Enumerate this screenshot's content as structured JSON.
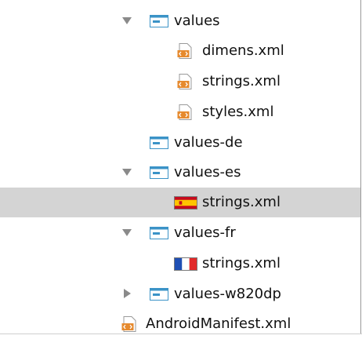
{
  "tree": {
    "items": [
      {
        "label": "values",
        "expanded": true,
        "type": "folder"
      },
      {
        "label": "dimens.xml",
        "type": "xml-file"
      },
      {
        "label": "strings.xml",
        "type": "xml-file"
      },
      {
        "label": "styles.xml",
        "type": "xml-file"
      },
      {
        "label": "values-de",
        "type": "folder"
      },
      {
        "label": "values-es",
        "expanded": true,
        "type": "folder"
      },
      {
        "label": "strings.xml",
        "type": "locale-file",
        "flag": "spain-flag-icon",
        "selected": true
      },
      {
        "label": "values-fr",
        "expanded": true,
        "type": "folder"
      },
      {
        "label": "strings.xml",
        "type": "locale-file",
        "flag": "france-flag-icon"
      },
      {
        "label": "values-w820dp",
        "expanded": false,
        "type": "folder"
      },
      {
        "label": "AndroidManifest.xml",
        "type": "xml-file"
      }
    ]
  },
  "colors": {
    "folder": "#3b93c7",
    "xml_icon": "#e68a2e",
    "selection": "#d4d4d4",
    "expand_arrow": "#8a8a8a"
  }
}
